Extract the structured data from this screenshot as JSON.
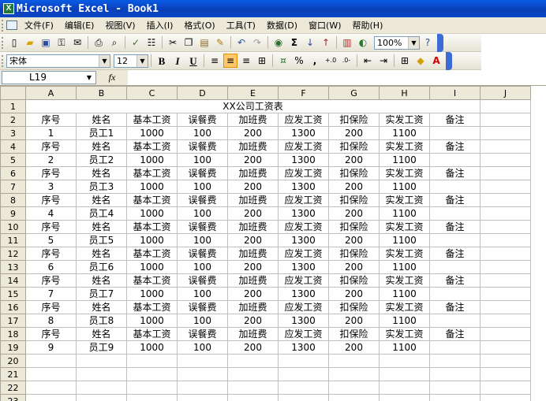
{
  "window": {
    "title": "Microsoft Excel - Book1"
  },
  "menu": [
    "文件(F)",
    "编辑(E)",
    "视图(V)",
    "插入(I)",
    "格式(O)",
    "工具(T)",
    "数据(D)",
    "窗口(W)",
    "帮助(H)"
  ],
  "toolbar": {
    "zoom": "100%",
    "font_name": "宋体",
    "font_size": "12",
    "bold": "B",
    "italic": "I",
    "underline": "U",
    "sigma": "Σ",
    "percent": "%",
    "comma": ","
  },
  "formula_bar": {
    "cell_ref": "L19",
    "fx": "fx",
    "formula": ""
  },
  "sheet": {
    "columns": [
      "A",
      "B",
      "C",
      "D",
      "E",
      "F",
      "G",
      "H",
      "I",
      "J"
    ],
    "title": "XX公司工资表",
    "headers": [
      "序号",
      "姓名",
      "基本工资",
      "误餐费",
      "加班费",
      "应发工资",
      "扣保险",
      "实发工资",
      "备注"
    ],
    "records": [
      [
        "1",
        "员工1",
        "1000",
        "100",
        "200",
        "1300",
        "200",
        "1100"
      ],
      [
        "2",
        "员工2",
        "1000",
        "100",
        "200",
        "1300",
        "200",
        "1100"
      ],
      [
        "3",
        "员工3",
        "1000",
        "100",
        "200",
        "1300",
        "200",
        "1100"
      ],
      [
        "4",
        "员工4",
        "1000",
        "100",
        "200",
        "1300",
        "200",
        "1100"
      ],
      [
        "5",
        "员工5",
        "1000",
        "100",
        "200",
        "1300",
        "200",
        "1100"
      ],
      [
        "6",
        "员工6",
        "1000",
        "100",
        "200",
        "1300",
        "200",
        "1100"
      ],
      [
        "7",
        "员工7",
        "1000",
        "100",
        "200",
        "1300",
        "200",
        "1100"
      ],
      [
        "8",
        "员工8",
        "1000",
        "100",
        "200",
        "1300",
        "200",
        "1100"
      ],
      [
        "9",
        "员工9",
        "1000",
        "100",
        "200",
        "1300",
        "200",
        "1100"
      ]
    ],
    "row_numbers": [
      "1",
      "2",
      "3",
      "4",
      "5",
      "6",
      "7",
      "8",
      "9",
      "10",
      "11",
      "12",
      "13",
      "14",
      "15",
      "16",
      "17",
      "18",
      "19",
      "20",
      "21",
      "22",
      "23"
    ]
  },
  "colors": {
    "titlebar": "#0a47c4",
    "chrome": "#ece9d8",
    "gridline": "#c0c0c0"
  }
}
